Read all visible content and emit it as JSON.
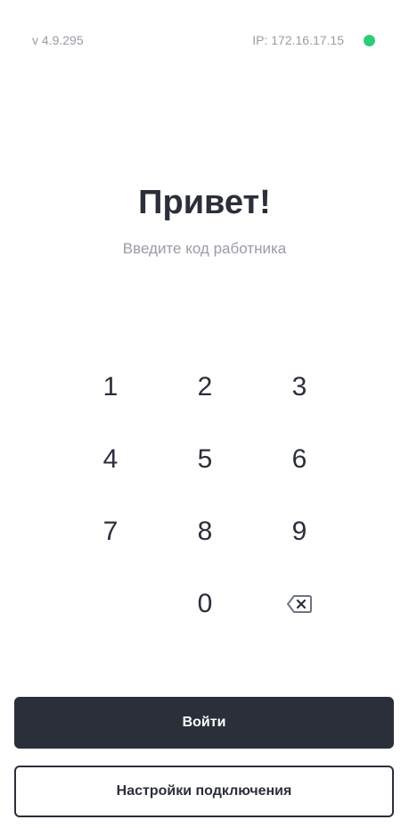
{
  "status": {
    "version": "v 4.9.295",
    "ip": "IP: 172.16.17.15",
    "connection_color": "#2ecc7a"
  },
  "greeting": {
    "title": "Привет!",
    "subtitle": "Введите код работника"
  },
  "keypad": {
    "k1": "1",
    "k2": "2",
    "k3": "3",
    "k4": "4",
    "k5": "5",
    "k6": "6",
    "k7": "7",
    "k8": "8",
    "k9": "9",
    "k0": "0",
    "backspace_icon": "backspace-icon"
  },
  "actions": {
    "login_label": "Войти",
    "settings_label": "Настройки подключения"
  },
  "colors": {
    "primary": "#2b2f3a",
    "muted": "#9a9ca6",
    "online": "#2ecc7a"
  }
}
